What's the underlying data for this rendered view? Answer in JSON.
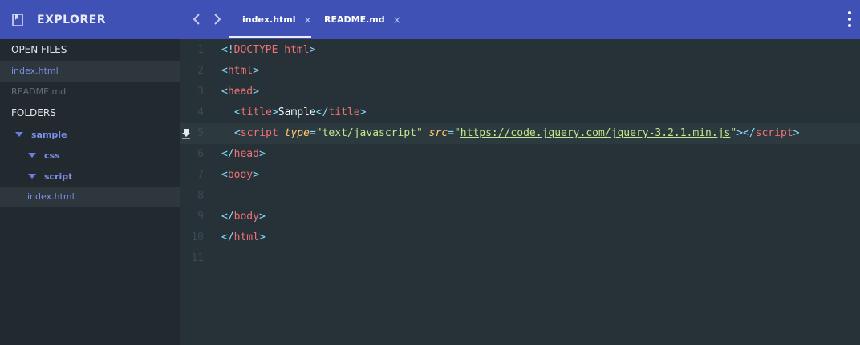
{
  "explorer": {
    "title": "EXPLORER",
    "open_files_title": "OPEN FILES",
    "open_files": [
      "index.html",
      "README.md"
    ],
    "folders_title": "FOLDERS",
    "tree": [
      {
        "name": "sample"
      },
      {
        "name": "css"
      },
      {
        "name": "script"
      },
      {
        "name": "index.html"
      }
    ]
  },
  "tabs": [
    {
      "label": "index.html",
      "close": "×",
      "active": true
    },
    {
      "label": "README.md",
      "close": "×",
      "active": false
    }
  ],
  "editor": {
    "line_numbers": [
      "1",
      "2",
      "3",
      "4",
      "5",
      "6",
      "7",
      "8",
      "9",
      "10",
      "11"
    ],
    "tokens": {
      "doctype_open": "<!",
      "doctype_kw": "DOCTYPE",
      "doctype_html": " html",
      "lt": "<",
      "gt": ">",
      "lt_slash": "</",
      "html": "html",
      "head": "head",
      "title": "title",
      "title_text": "Sample",
      "script": "script",
      "type_attr": "type",
      "type_val": "\"text/javascript\"",
      "src_attr": "src",
      "eq": "=",
      "quote": "\"",
      "src_url": "https://code.jquery.com/jquery-3.2.1.min.js",
      "body": "body"
    }
  },
  "colors": {
    "accent": "#3f51b5",
    "sidebar_bg": "#222a30",
    "editor_bg": "#263238",
    "tag": "#f07178",
    "bracket": "#89ddff",
    "attr": "#ffcb6b",
    "string": "#c3e88d"
  }
}
